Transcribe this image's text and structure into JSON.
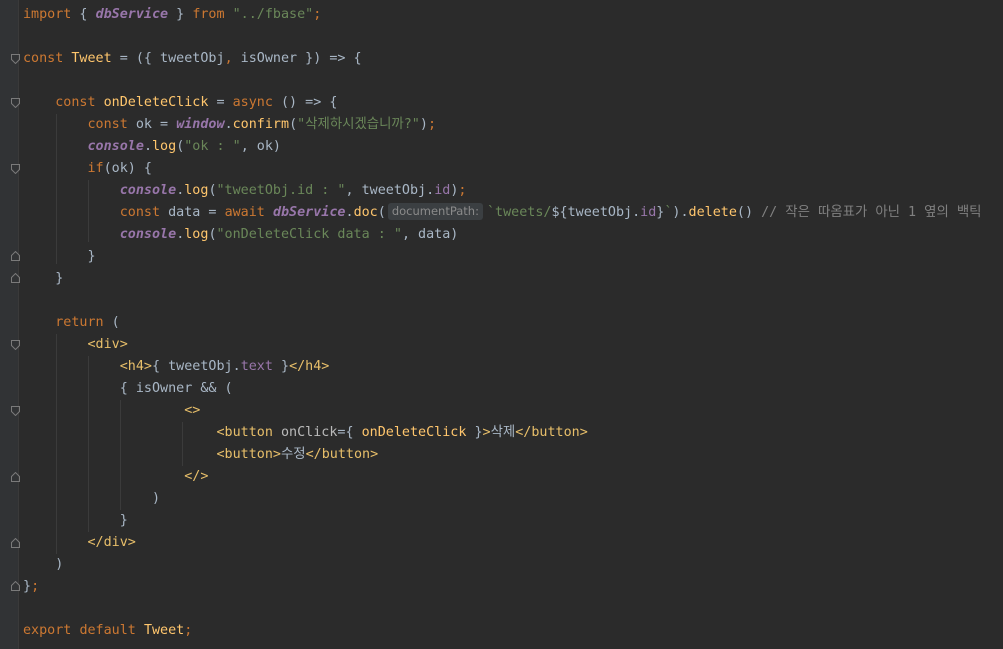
{
  "lines": [
    {
      "tokens": [
        {
          "t": "import",
          "c": "kw"
        },
        {
          "t": " { "
        },
        {
          "t": "dbService",
          "c": "it"
        },
        {
          "t": " } "
        },
        {
          "t": "from",
          "c": "kw"
        },
        {
          "t": " "
        },
        {
          "t": "\"../fbase\"",
          "c": "str"
        },
        {
          "t": ";",
          "c": "kw"
        }
      ]
    },
    {
      "tokens": []
    },
    {
      "tokens": [
        {
          "t": "const ",
          "c": "kw"
        },
        {
          "t": "Tweet",
          "c": "fn"
        },
        {
          "t": " = ({ tweetObj"
        },
        {
          "t": ",",
          "c": "kw"
        },
        {
          "t": " isOwner }) => {"
        }
      ]
    },
    {
      "tokens": []
    },
    {
      "tokens": [
        {
          "t": "    "
        },
        {
          "t": "const ",
          "c": "kw"
        },
        {
          "t": "onDeleteClick",
          "c": "fn"
        },
        {
          "t": " = "
        },
        {
          "t": "async",
          "c": "kw"
        },
        {
          "t": " () => {"
        }
      ]
    },
    {
      "tokens": [
        {
          "t": "        "
        },
        {
          "t": "const ",
          "c": "kw"
        },
        {
          "t": "ok = "
        },
        {
          "t": "window",
          "c": "it"
        },
        {
          "t": "."
        },
        {
          "t": "confirm",
          "c": "fn"
        },
        {
          "t": "("
        },
        {
          "t": "\"삭제하시겠습니까?\"",
          "c": "str"
        },
        {
          "t": ")"
        },
        {
          "t": ";",
          "c": "kw"
        }
      ]
    },
    {
      "tokens": [
        {
          "t": "        "
        },
        {
          "t": "console",
          "c": "it"
        },
        {
          "t": "."
        },
        {
          "t": "log",
          "c": "fn"
        },
        {
          "t": "("
        },
        {
          "t": "\"ok : \"",
          "c": "str"
        },
        {
          "t": ","
        },
        {
          "t": " ok)"
        }
      ]
    },
    {
      "tokens": [
        {
          "t": "        "
        },
        {
          "t": "if",
          "c": "kw"
        },
        {
          "t": "(ok) {"
        }
      ]
    },
    {
      "tokens": [
        {
          "t": "            "
        },
        {
          "t": "console",
          "c": "it"
        },
        {
          "t": "."
        },
        {
          "t": "log",
          "c": "fn"
        },
        {
          "t": "("
        },
        {
          "t": "\"tweetObj.id : \"",
          "c": "str"
        },
        {
          "t": ","
        },
        {
          "t": " tweetObj."
        },
        {
          "t": "id",
          "c": "prop"
        },
        {
          "t": ")"
        },
        {
          "t": ";",
          "c": "kw"
        }
      ]
    },
    {
      "tokens": [
        {
          "t": "            "
        },
        {
          "t": "const ",
          "c": "kw"
        },
        {
          "t": "data = "
        },
        {
          "t": "await ",
          "c": "kw"
        },
        {
          "t": "dbService",
          "c": "it"
        },
        {
          "t": "."
        },
        {
          "t": "doc",
          "c": "fn"
        },
        {
          "t": "("
        },
        {
          "t": "documentPath:",
          "c": "hint"
        },
        {
          "t": "`tweets/",
          "c": "str"
        },
        {
          "t": "${"
        },
        {
          "t": "tweetObj."
        },
        {
          "t": "id",
          "c": "prop"
        },
        {
          "t": "}"
        },
        {
          "t": "`",
          "c": "str"
        },
        {
          "t": ")."
        },
        {
          "t": "delete",
          "c": "fn"
        },
        {
          "t": "() "
        },
        {
          "t": "// 작은 따옴표가 아닌 1 옆의 백틱",
          "c": "cmt"
        }
      ]
    },
    {
      "tokens": [
        {
          "t": "            "
        },
        {
          "t": "console",
          "c": "it"
        },
        {
          "t": "."
        },
        {
          "t": "log",
          "c": "fn"
        },
        {
          "t": "("
        },
        {
          "t": "\"onDeleteClick data : \"",
          "c": "str"
        },
        {
          "t": ","
        },
        {
          "t": " data)"
        }
      ]
    },
    {
      "tokens": [
        {
          "t": "        }"
        }
      ]
    },
    {
      "tokens": [
        {
          "t": "    }"
        }
      ]
    },
    {
      "tokens": []
    },
    {
      "tokens": [
        {
          "t": "    "
        },
        {
          "t": "return",
          "c": "kw"
        },
        {
          "t": " ("
        }
      ]
    },
    {
      "tokens": [
        {
          "t": "        "
        },
        {
          "t": "<div>",
          "c": "tag"
        }
      ]
    },
    {
      "tokens": [
        {
          "t": "            "
        },
        {
          "t": "<h4>",
          "c": "tag"
        },
        {
          "t": "{ tweetObj."
        },
        {
          "t": "text",
          "c": "prop"
        },
        {
          "t": " }"
        },
        {
          "t": "</h4>",
          "c": "tag"
        }
      ]
    },
    {
      "tokens": [
        {
          "t": "            { isOwner && ("
        }
      ]
    },
    {
      "tokens": [
        {
          "t": "                    "
        },
        {
          "t": "<>",
          "c": "tag"
        }
      ]
    },
    {
      "tokens": [
        {
          "t": "                        "
        },
        {
          "t": "<button ",
          "c": "tag"
        },
        {
          "t": "onClick",
          "c": "attr"
        },
        {
          "t": "={ "
        },
        {
          "t": "onDeleteClick",
          "c": "fn"
        },
        {
          "t": " }"
        },
        {
          "t": ">",
          "c": "tag"
        },
        {
          "t": "삭제"
        },
        {
          "t": "</button>",
          "c": "tag"
        }
      ]
    },
    {
      "tokens": [
        {
          "t": "                        "
        },
        {
          "t": "<button>",
          "c": "tag"
        },
        {
          "t": "수정"
        },
        {
          "t": "</button>",
          "c": "tag"
        }
      ]
    },
    {
      "tokens": [
        {
          "t": "                    "
        },
        {
          "t": "</>",
          "c": "tag"
        }
      ]
    },
    {
      "tokens": [
        {
          "t": "                )"
        }
      ]
    },
    {
      "tokens": [
        {
          "t": "            }"
        }
      ]
    },
    {
      "tokens": [
        {
          "t": "        "
        },
        {
          "t": "</div>",
          "c": "tag"
        }
      ]
    },
    {
      "tokens": [
        {
          "t": "    )"
        }
      ]
    },
    {
      "tokens": [
        {
          "t": "}"
        },
        {
          "t": ";",
          "c": "kw"
        }
      ]
    },
    {
      "tokens": []
    },
    {
      "tokens": [
        {
          "t": "export ",
          "c": "kw"
        },
        {
          "t": "default ",
          "c": "kw"
        },
        {
          "t": "Tweet",
          "c": "fn"
        },
        {
          "t": ";",
          "c": "kw"
        }
      ]
    }
  ]
}
